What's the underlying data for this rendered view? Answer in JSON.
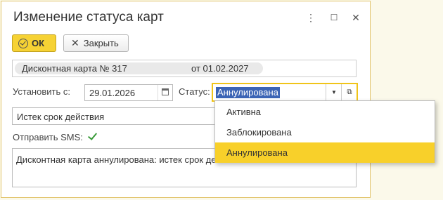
{
  "window": {
    "title": "Изменение статуса карт",
    "menu_icon": "⋮",
    "maximize_icon": "☐",
    "close_icon": "✕"
  },
  "toolbar": {
    "ok_label": "ОК",
    "close_label": "Закрыть"
  },
  "info": {
    "card": "Дисконтная карта № 317",
    "date": "от 01.02.2027"
  },
  "form": {
    "set_label": "Установить с:",
    "set_date": "29.01.2026",
    "status_label": "Статус:",
    "status_value": "Аннулирована",
    "reason_value": "Истек срок действия",
    "sms_label": "Отправить SMS:",
    "sms_checked": true,
    "comment": "Дисконтная карта аннулирована: истек срок действия"
  },
  "dropdown": {
    "options": [
      "Активна",
      "Заблокирована",
      "Аннулирована"
    ],
    "selected": "Аннулирована"
  },
  "colors": {
    "accent": "#f6d234",
    "selection": "#3b64b5",
    "window_border": "#e1c36a"
  }
}
